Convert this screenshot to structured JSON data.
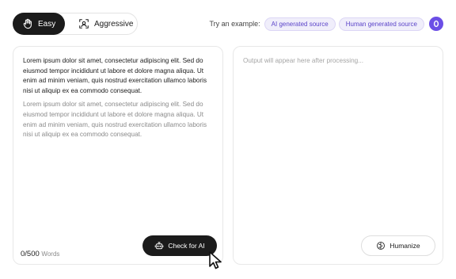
{
  "modes": {
    "easy_label": "Easy",
    "easy_icon": "hand-icon",
    "aggressive_label": "Aggressive",
    "aggressive_icon": "scan-icon",
    "active": "Easy"
  },
  "examples": {
    "prompt": "Try an example:",
    "ai_label": "AI generated source",
    "human_label": "Human generated source",
    "extra_icon": "circle-icon"
  },
  "input_panel": {
    "paragraph_1": "Lorem ipsum dolor sit amet, consectetur adipiscing elit. Sed do eiusmod tempor incididunt ut labore et dolore magna aliqua. Ut enim ad minim veniam, quis nostrud exercitation ullamco laboris nisi ut aliquip ex ea commodo consequat.",
    "paragraph_2": "Lorem ipsum dolor sit amet, consectetur adipiscing elit. Sed do eiusmod tempor incididunt ut labore et dolore magna aliqua. Ut enim ad minim veniam, quis nostrud exercitation ullamco laboris nisi ut aliquip ex ea commodo consequat.",
    "word_count": "0/500",
    "word_unit": "Words",
    "check_label": "Check for AI",
    "check_icon": "robot-icon"
  },
  "output_panel": {
    "placeholder": "Output will appear here after processing...",
    "humanize_label": "Humanize",
    "humanize_icon": "brain-icon"
  },
  "colors": {
    "accent": "#6b4ee6",
    "dark": "#1b1b1b",
    "pill_bg": "#f0eefb"
  }
}
